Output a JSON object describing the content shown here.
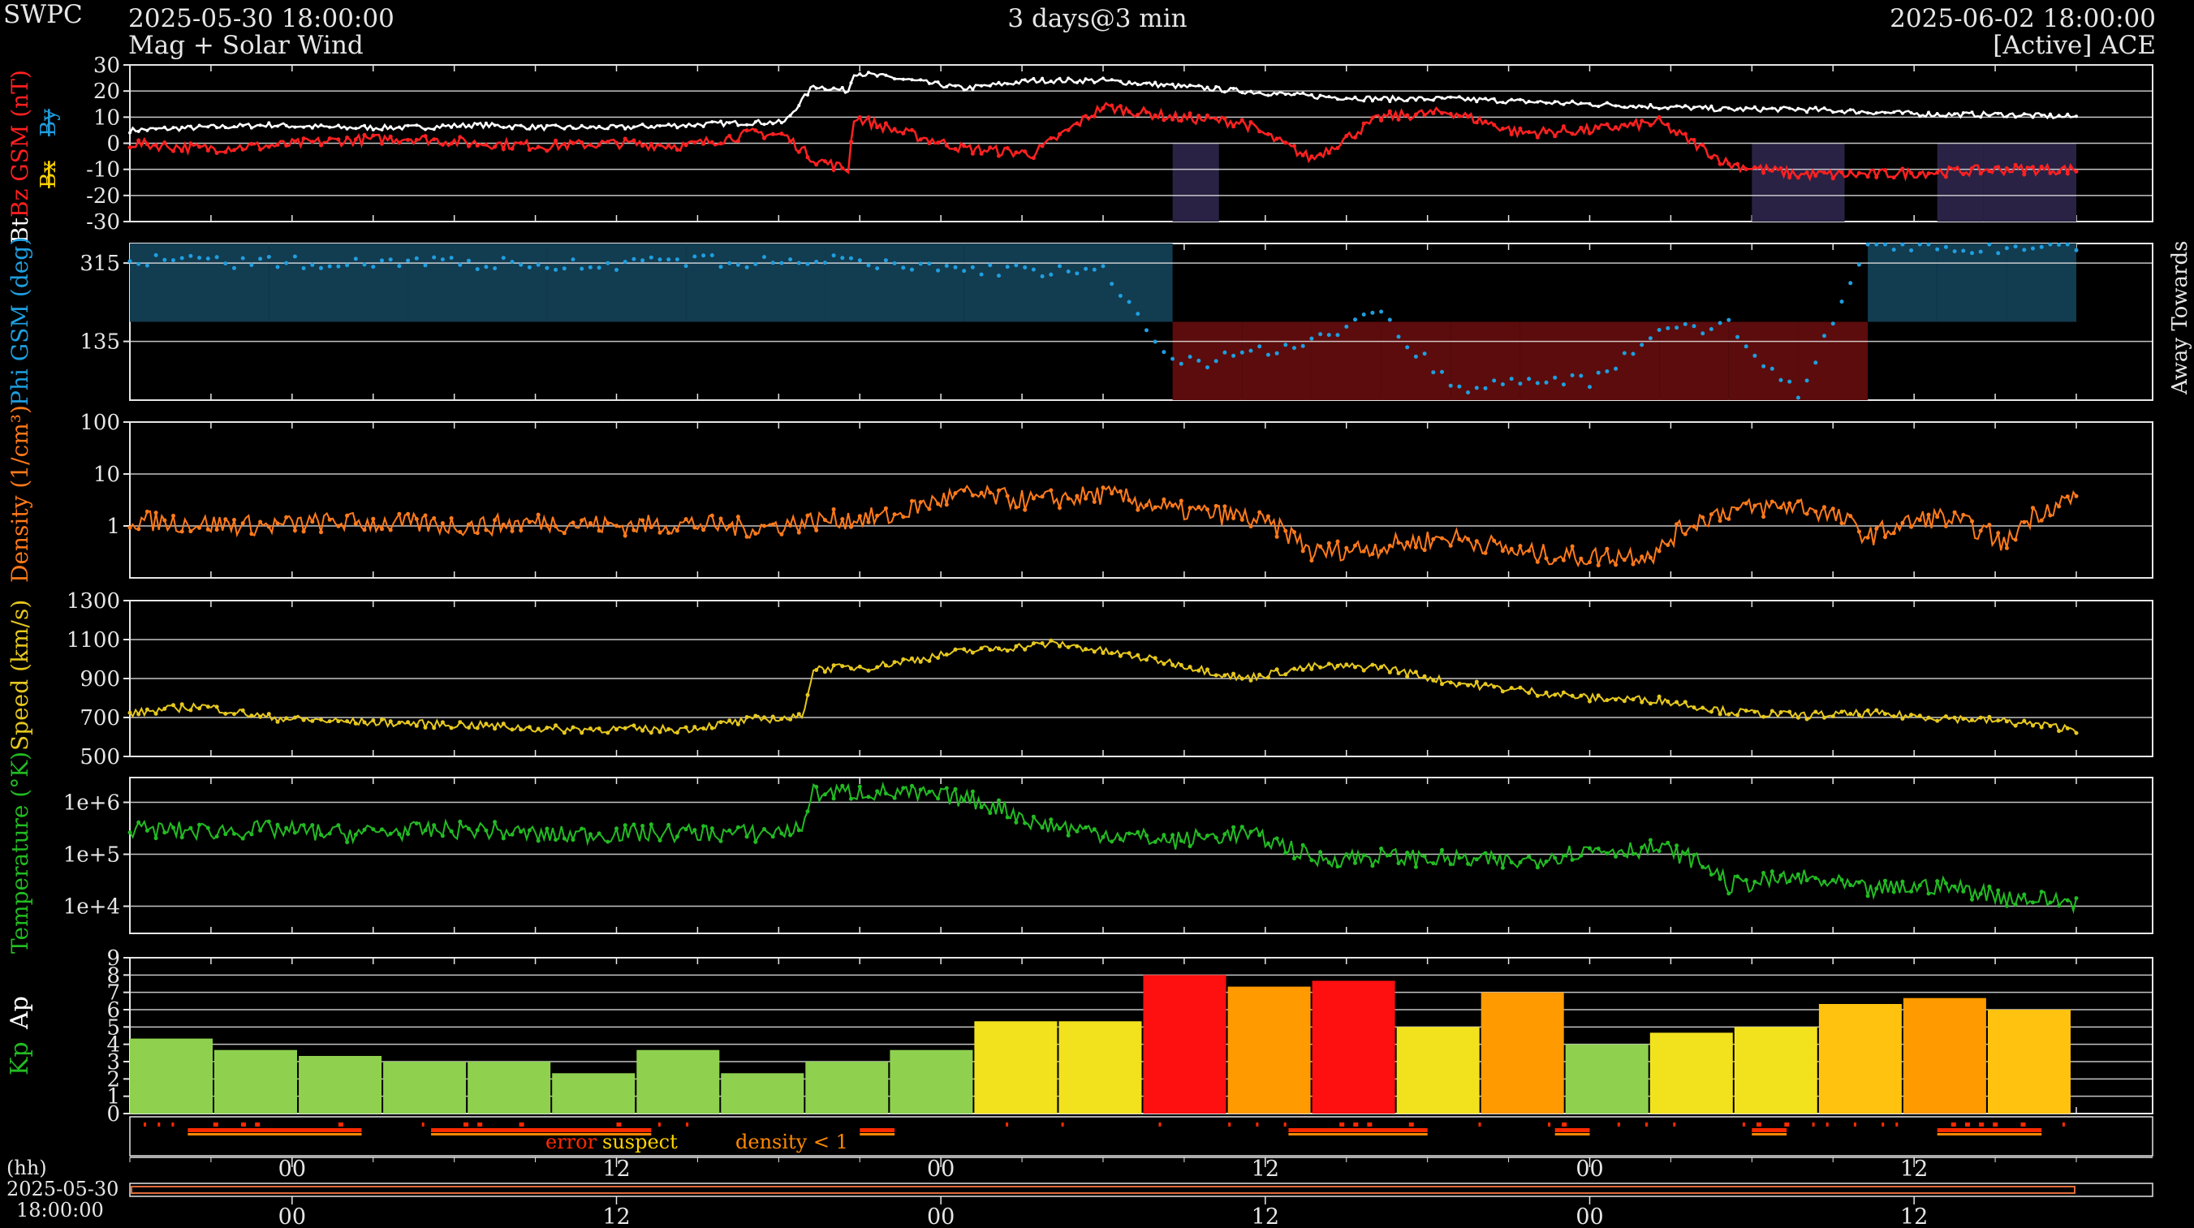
{
  "header": {
    "org": "SWPC",
    "start": "2025-05-30 18:00:00",
    "product": "Mag + Solar Wind",
    "span": "3 days@3 min",
    "end": "2025-06-02 18:00:00",
    "source": "[Active] ACE"
  },
  "colors": {
    "bg": "#000000",
    "grid": "#e6e6e6",
    "bz": "#ff2020",
    "bt": "#ffffff",
    "bx": "#ffd400",
    "by": "#1e9fe0",
    "phi": "#1e9fe0",
    "phi_away_fill": "#123c50",
    "phi_toward_fill": "#5c0c0c",
    "bz_neg_fill": "#2a2244",
    "density": "#ff7a1a",
    "speed": "#e6c81e",
    "temperature": "#22bb22",
    "kp_green": "#8fd14f",
    "kp_yellow": "#f2e21e",
    "kp_gold": "#ffc20e",
    "kp_orange": "#ff9a00",
    "kp_red": "#ff1010",
    "err": "#ff2a00",
    "suspect": "#ffd400",
    "dens_flag": "#ff8a00"
  },
  "chart_data": [
    {
      "type": "line",
      "panel": "mag",
      "ylabel": [
        "Bz GSM (nT)",
        "Bx",
        "By",
        "Bt"
      ],
      "yticks": [
        "30",
        "20",
        "10",
        "0",
        "-10",
        "-20",
        "-30"
      ],
      "ylim": [
        -30,
        30
      ],
      "x": [
        0,
        6,
        12,
        18,
        24,
        30,
        36,
        42,
        48,
        54,
        56.5,
        59,
        62,
        62.5,
        66,
        72,
        78,
        84,
        90,
        96,
        102,
        108,
        114,
        120,
        126,
        132,
        138,
        144,
        150,
        156,
        162,
        168
      ],
      "series": [
        {
          "name": "Bt",
          "values": [
            5,
            6,
            7,
            6,
            6,
            7,
            6,
            6,
            7,
            8,
            8,
            22,
            20,
            27,
            25,
            21,
            24,
            24,
            22,
            20,
            18,
            17,
            17,
            16,
            15,
            14,
            13,
            13,
            12,
            11,
            11,
            10
          ]
        },
        {
          "name": "Bz",
          "values": [
            0,
            -2,
            -1,
            1,
            2,
            0,
            -1,
            0,
            -1,
            4,
            3,
            -6,
            -10,
            10,
            5,
            -2,
            -4,
            14,
            10,
            8,
            -6,
            10,
            12,
            4,
            5,
            8,
            -8,
            -12,
            -12,
            -11,
            -10,
            -10
          ]
        }
      ]
    },
    {
      "type": "scatter",
      "panel": "phi",
      "ylabel": "Phi GSM (deg)",
      "yticks": [
        "315",
        "135"
      ],
      "ylim": [
        0,
        360
      ],
      "right_label": "Away Towards",
      "x": [
        0,
        12,
        24,
        36,
        48,
        60,
        72,
        84,
        90,
        96,
        102,
        108,
        114,
        120,
        126,
        132,
        138,
        144,
        150,
        156,
        162,
        168
      ],
      "values": [
        320,
        315,
        320,
        310,
        318,
        320,
        300,
        295,
        80,
        100,
        140,
        200,
        30,
        40,
        45,
        155,
        175,
        10,
        360,
        355,
        350,
        355
      ],
      "sector": [
        "away",
        "away",
        "away",
        "away",
        "away",
        "away",
        "away",
        "away",
        "toward",
        "toward",
        "toward",
        "toward",
        "toward",
        "toward",
        "toward",
        "toward",
        "toward",
        "toward",
        "away",
        "away",
        "away",
        "away"
      ]
    },
    {
      "type": "line",
      "panel": "density",
      "ylabel": "Density (1/cm³)",
      "yticks": [
        "100",
        "10",
        "1"
      ],
      "yscale": "log",
      "ylim": [
        0.1,
        100
      ],
      "x": [
        0,
        6,
        12,
        18,
        24,
        30,
        36,
        42,
        48,
        54,
        60,
        66,
        72,
        78,
        84,
        90,
        96,
        102,
        108,
        114,
        120,
        126,
        132,
        138,
        144,
        150,
        156,
        162,
        168
      ],
      "values": [
        1.3,
        1.1,
        1.0,
        1.2,
        1.1,
        1.0,
        1.2,
        1.0,
        1.1,
        0.9,
        1.3,
        1.5,
        4,
        3,
        4,
        2,
        1.5,
        0.3,
        0.4,
        0.6,
        0.3,
        0.25,
        0.3,
        2,
        2.5,
        0.6,
        1.5,
        0.4,
        3.5
      ]
    },
    {
      "type": "line",
      "panel": "speed",
      "ylabel": "Speed (km/s)",
      "yticks": [
        "1300",
        "1100",
        "900",
        "700",
        "500"
      ],
      "ylim": [
        500,
        1300
      ],
      "x": [
        0,
        6,
        12,
        18,
        24,
        30,
        36,
        42,
        48,
        54,
        58,
        59,
        64,
        72,
        80,
        90,
        96,
        102,
        108,
        114,
        120,
        126,
        132,
        138,
        144,
        150,
        156,
        162,
        168
      ],
      "values": [
        720,
        760,
        700,
        680,
        670,
        660,
        640,
        640,
        640,
        690,
        700,
        950,
        960,
        1040,
        1080,
        980,
        900,
        960,
        960,
        880,
        840,
        800,
        790,
        730,
        710,
        720,
        700,
        680,
        640
      ]
    },
    {
      "type": "line",
      "panel": "temperature",
      "ylabel": "Temperature (°K)",
      "yticks": [
        "1e+6",
        "1e+5",
        "1e+4"
      ],
      "yscale": "log",
      "ylim": [
        3000,
        3000000
      ],
      "x": [
        0,
        6,
        12,
        18,
        24,
        30,
        36,
        42,
        48,
        54,
        58,
        59,
        64,
        72,
        78,
        84,
        90,
        96,
        102,
        108,
        114,
        120,
        126,
        132,
        138,
        144,
        150,
        156,
        162,
        168
      ],
      "values": [
        300000,
        280000,
        300000,
        250000,
        280000,
        300000,
        230000,
        250000,
        260000,
        250000,
        300000,
        1500000,
        1600000,
        1200000,
        400000,
        250000,
        180000,
        250000,
        80000,
        90000,
        80000,
        70000,
        120000,
        130000,
        25000,
        35000,
        20000,
        25000,
        15000,
        12000
      ]
    },
    {
      "type": "bar",
      "panel": "kp",
      "ylabel": [
        "Kp",
        "Ap"
      ],
      "yticks": [
        "9",
        "8",
        "7",
        "6",
        "5",
        "4",
        "3",
        "2",
        "1",
        "0"
      ],
      "ylim": [
        0,
        9
      ],
      "values": [
        4.33,
        3.67,
        3.33,
        3.0,
        3.0,
        2.33,
        3.67,
        2.33,
        3.0,
        3.67,
        5.33,
        5.33,
        8.0,
        7.33,
        7.67,
        5.0,
        7.0,
        4.0,
        4.67,
        5.0,
        6.33,
        6.67,
        6.0
      ],
      "bar_colors": [
        "kp_green",
        "kp_green",
        "kp_green",
        "kp_green",
        "kp_green",
        "kp_green",
        "kp_green",
        "kp_green",
        "kp_green",
        "kp_green",
        "kp_yellow",
        "kp_yellow",
        "kp_red",
        "kp_orange",
        "kp_red",
        "kp_yellow",
        "kp_orange",
        "kp_green",
        "kp_yellow",
        "kp_yellow",
        "kp_gold",
        "kp_orange",
        "kp_gold"
      ]
    }
  ],
  "legend": {
    "error": "error",
    "suspect": "suspect",
    "density": "density < 1"
  },
  "xaxis": {
    "label": "(hh)",
    "ticks": [
      "00",
      "12",
      "00",
      "12",
      "00",
      "12"
    ],
    "bottom_ticks": [
      "00",
      "12",
      "00",
      "12",
      "00",
      "12"
    ],
    "start_date": "2025-05-30",
    "start_time": "18:00:00"
  }
}
